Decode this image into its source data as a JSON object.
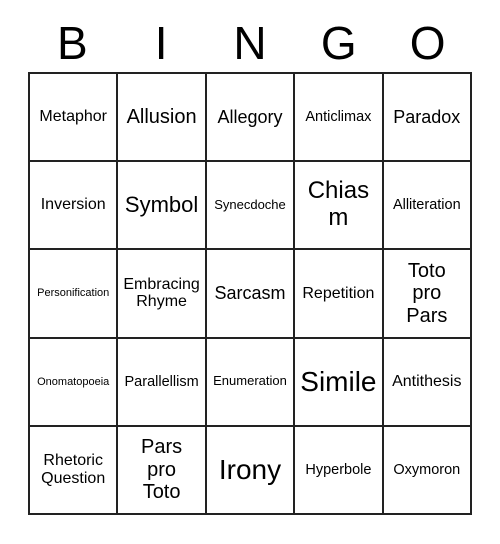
{
  "card": {
    "title": "BINGO",
    "header_letters": [
      "B",
      "I",
      "N",
      "G",
      "O"
    ],
    "colors": {
      "background": "#ffffff",
      "border": "#222222",
      "text": "#000000"
    },
    "grid": {
      "rows": 5,
      "columns": 5
    },
    "cells": [
      {
        "text": "Metaphor",
        "size": "fs-m"
      },
      {
        "text": "Allusion",
        "size": "fs-l"
      },
      {
        "text": "Allegory",
        "size": "fs-ml"
      },
      {
        "text": "Anticlimax",
        "size": "fs-s"
      },
      {
        "text": "Paradox",
        "size": "fs-ml"
      },
      {
        "text": "Inversion",
        "size": "fs-m"
      },
      {
        "text": "Symbol",
        "size": "fs-xl"
      },
      {
        "text": "Synecdoche",
        "size": "fs-xs"
      },
      {
        "text": "Chiasm",
        "size": "fs-xxl"
      },
      {
        "text": "Alliteration",
        "size": "fs-s"
      },
      {
        "text": "Personification",
        "size": "fs-xxs"
      },
      {
        "text": "Embracing\nRhyme",
        "size": "fs-m"
      },
      {
        "text": "Sarcasm",
        "size": "fs-ml"
      },
      {
        "text": "Repetition",
        "size": "fs-m"
      },
      {
        "text": "Toto\npro\nPars",
        "size": "fs-l"
      },
      {
        "text": "Onomatopoeia",
        "size": "fs-xxs"
      },
      {
        "text": "Parallellism",
        "size": "fs-s"
      },
      {
        "text": "Enumeration",
        "size": "fs-xs"
      },
      {
        "text": "Simile",
        "size": "fs-3xl"
      },
      {
        "text": "Antithesis",
        "size": "fs-m"
      },
      {
        "text": "Rhetoric\nQuestion",
        "size": "fs-m"
      },
      {
        "text": "Pars\npro\nToto",
        "size": "fs-l"
      },
      {
        "text": "Irony",
        "size": "fs-3xl"
      },
      {
        "text": "Hyperbole",
        "size": "fs-s"
      },
      {
        "text": "Oxymoron",
        "size": "fs-s"
      }
    ]
  }
}
